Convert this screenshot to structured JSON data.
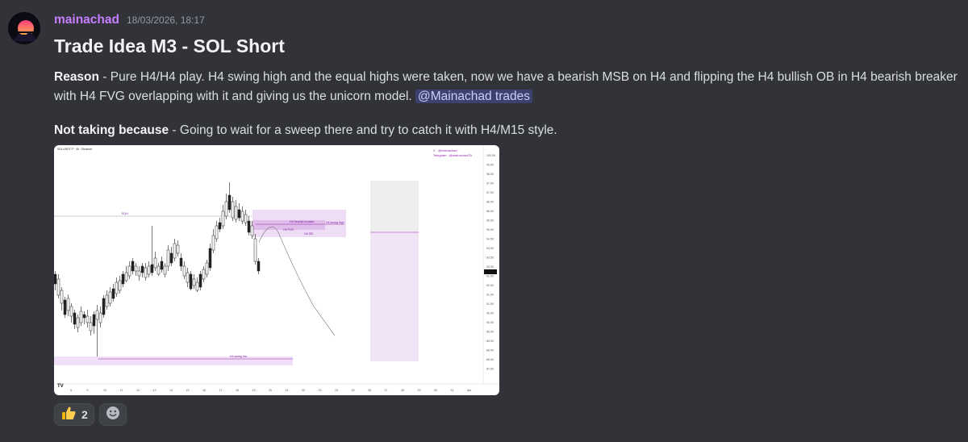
{
  "message": {
    "username": "mainachad",
    "timestamp": "18/03/2026, 18:17",
    "title": "Trade Idea M3 - SOL Short",
    "reason_label": "Reason",
    "reason_text": " - Pure H4/H4 play. H4 swing high and the equal highs were taken, now we have a bearish MSB on H4 and flipping the H4 bullish OB in H4 bearish breaker with H4 FVG overlapping with it and giving us the unicorn model. ",
    "mention": "@Mainachad trades",
    "not_taking_label": "Not taking because",
    "not_taking_text": " - Going to wait for a sweep there and try to catch it with H4/M15 style."
  },
  "chart_image": {
    "symbol_line": "SOLUSDT.P · 4h · Binance",
    "watermark_handle": "X : @mainachad",
    "watermark_telegram": "Telegram : @mainachadTA",
    "labels": {
      "h4_bearish_breaker": "H4 bearish breaker",
      "h4_fvg": "H4 FVG",
      "h4_swing_high": "H4 swing high",
      "h4_ob": "H4 OB",
      "h4_swing_low": "H4 swing low",
      "eqh": "EQH"
    },
    "x_ticks": [
      "5",
      "9",
      "10",
      "11",
      "12",
      "13",
      "14",
      "15",
      "16",
      "17",
      "18",
      "19",
      "20",
      "21",
      "22",
      "23",
      "24",
      "25",
      "26",
      "27",
      "28",
      "29",
      "30",
      "31",
      "Apr"
    ],
    "y_ticks": [
      "100.00",
      "99.50",
      "98.00",
      "97.50",
      "97.00",
      "96.50",
      "96.00",
      "95.50",
      "95.00",
      "94.50",
      "94.00",
      "93.50",
      "93.00",
      "92.50",
      "92.00",
      "91.50",
      "91.00",
      "90.50",
      "90.00",
      "89.50",
      "89.00",
      "88.50",
      "88.00",
      "87.50"
    ]
  },
  "reactions": [
    {
      "icon": "thumbs-up-icon",
      "emoji": "👍",
      "count": "2"
    }
  ],
  "colors": {
    "background": "#323339",
    "username": "#c77dff",
    "mention_bg": "#3c4270",
    "zone_purple": "#9c27b0"
  }
}
